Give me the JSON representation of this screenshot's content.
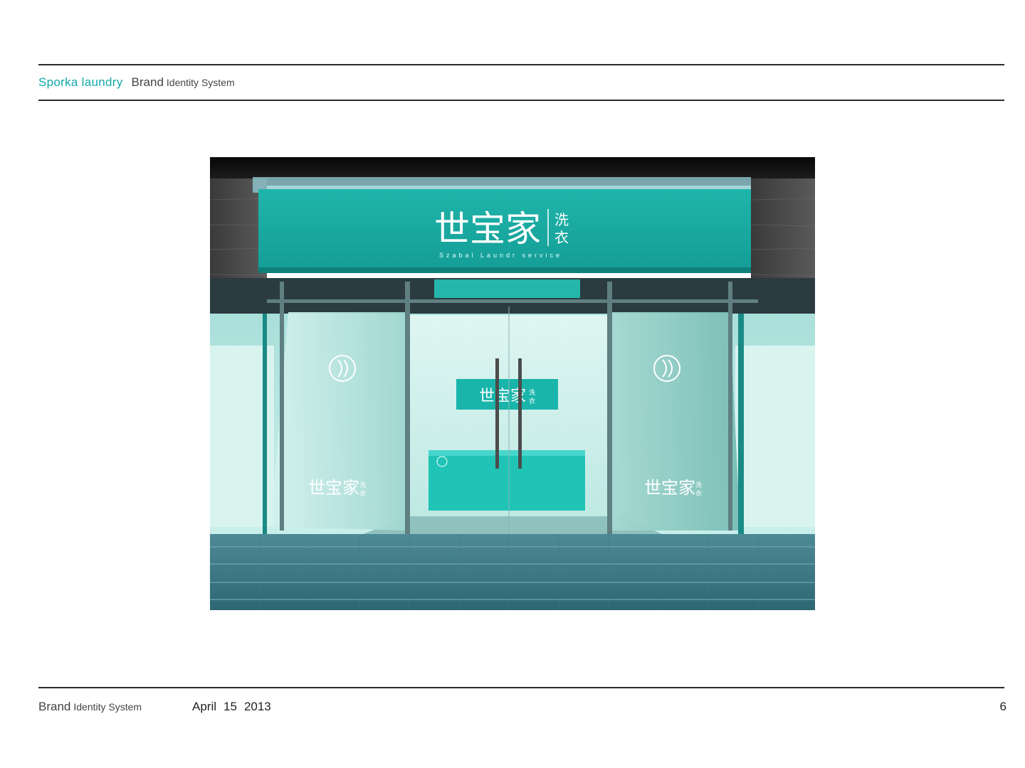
{
  "header": {
    "brand_name": "Sporka laundry",
    "doc_title_big": "Brand",
    "doc_title_small": "Identity System"
  },
  "footer": {
    "doc_title_big": "Brand",
    "doc_title_small": "Identity System",
    "date_month": "April",
    "date_day": "15",
    "date_year": "2013",
    "page_number": "6"
  },
  "storefront": {
    "sign_chinese": "世宝家",
    "sign_chinese_side_top": "洗",
    "sign_chinese_side_bottom": "衣",
    "sign_subtitle": "Szabal Laundr service"
  },
  "colors": {
    "accent": "#11a8a8",
    "sign_teal": "#1aa9a0",
    "glass": "#bfe9e4"
  }
}
